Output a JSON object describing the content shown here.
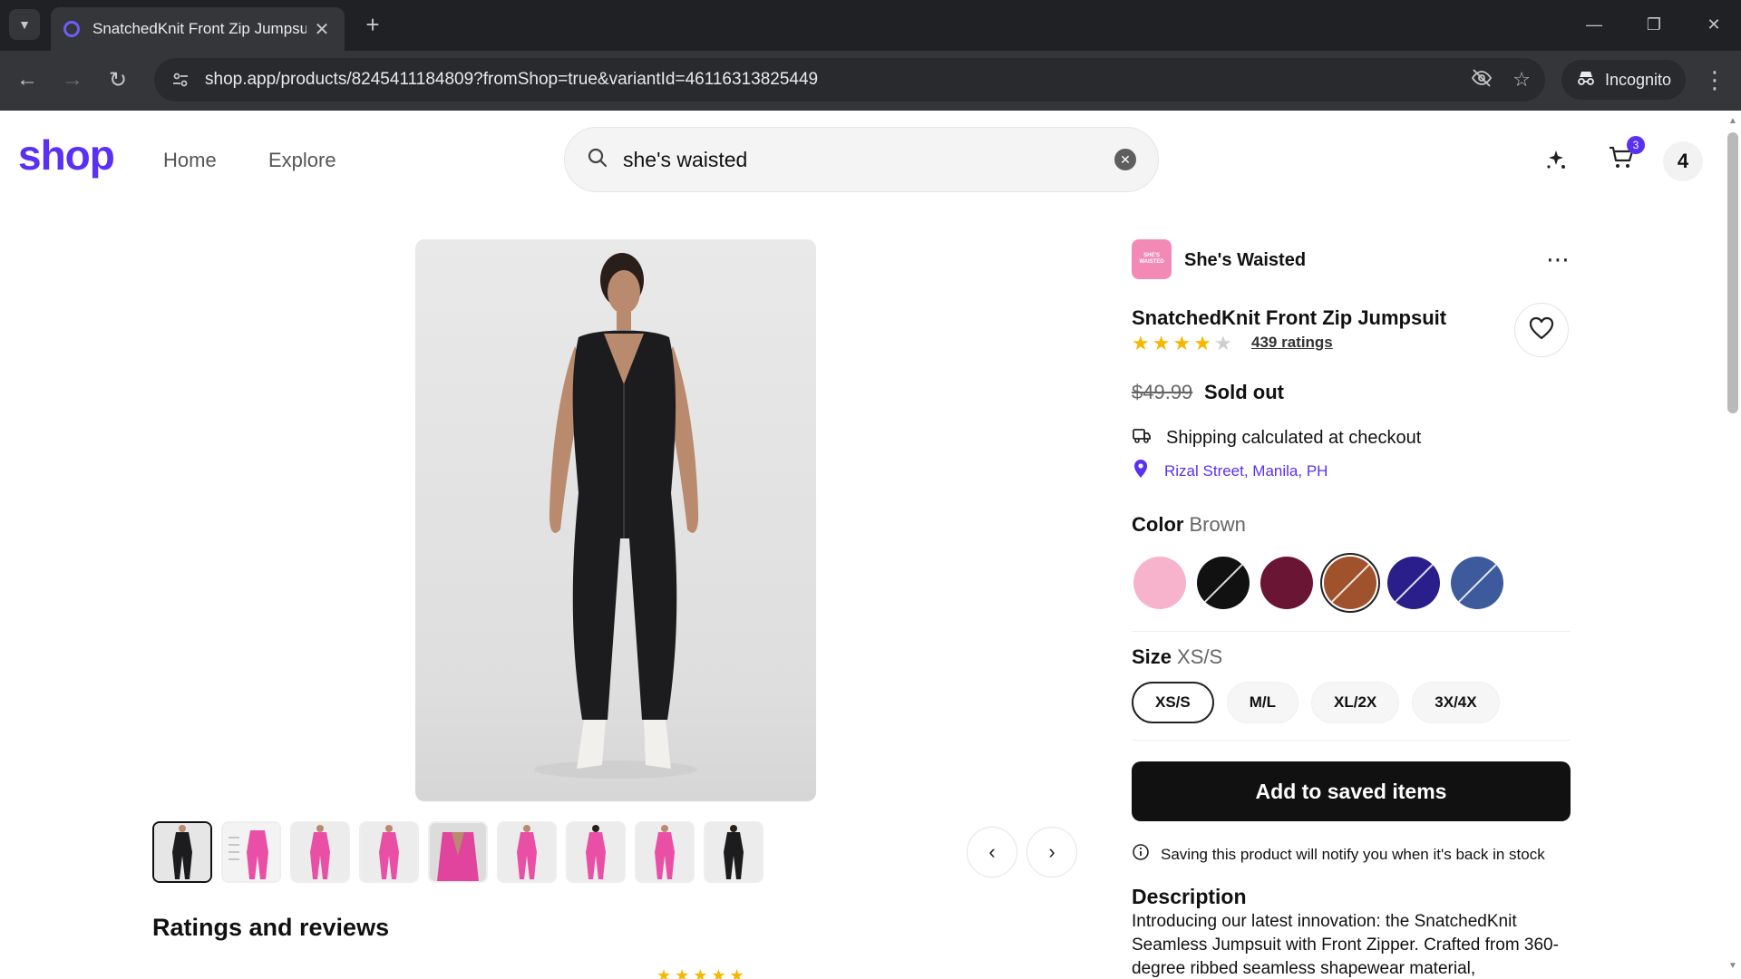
{
  "browser": {
    "tab_title": "SnatchedKnit Front Zip Jumpsuit",
    "url": "shop.app/products/8245411184809?fromShop=true&variantId=46116313825449",
    "incognito_label": "Incognito"
  },
  "header": {
    "logo": "shop",
    "nav": [
      "Home",
      "Explore"
    ],
    "search_query": "she's waisted",
    "cart_count": "3",
    "avatar_initial": "4"
  },
  "gallery": {
    "thumbnail_count": 9,
    "active_thumbnail": 0,
    "reviews_heading": "Ratings and reviews"
  },
  "product": {
    "shop_name": "She's Waisted",
    "shop_logo_text": "SHE'S WAISTED",
    "title": "SnatchedKnit Front Zip Jumpsuit",
    "rating": 4,
    "ratings_label": "439 ratings",
    "price": "$49.99",
    "status": "Sold out",
    "shipping": "Shipping calculated at checkout",
    "location": "Rizal Street, Manila, PH",
    "color_label": "Color",
    "color_value": "Brown",
    "colors": [
      {
        "name": "Pink",
        "hex": "#f7b3cc",
        "sold_out": false
      },
      {
        "name": "Black",
        "hex": "#111111",
        "sold_out": true
      },
      {
        "name": "Burgundy",
        "hex": "#6b1535",
        "sold_out": false
      },
      {
        "name": "Brown",
        "hex": "#a0522d",
        "sold_out": true,
        "selected": true
      },
      {
        "name": "Navy",
        "hex": "#2a1f8a",
        "sold_out": true
      },
      {
        "name": "Blue",
        "hex": "#3d5a9c",
        "sold_out": true
      }
    ],
    "size_label": "Size",
    "size_value": "XS/S",
    "sizes": [
      "XS/S",
      "M/L",
      "XL/2X",
      "3X/4X"
    ],
    "selected_size": 0,
    "save_button": "Add to saved items",
    "notice": "Saving this product will notify you when it's back in stock",
    "description_heading": "Description",
    "description": "Introducing our latest innovation: the SnatchedKnit Seamless Jumpsuit with Front Zipper. Crafted from 360-degree ribbed seamless shapewear material,"
  },
  "colors": {
    "brand": "#5a31f4",
    "star": "#f5b800"
  }
}
